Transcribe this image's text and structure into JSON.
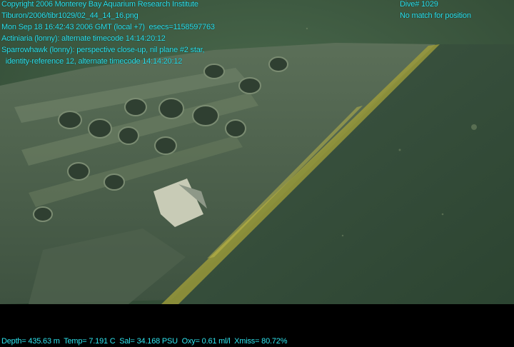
{
  "overlay": {
    "copyright": "Copyright 2006 Monterey Bay Aquarium Research Institute",
    "filename": "Tiburon/2006/tibr1029/02_44_14_16.png",
    "datetime": "Mon Sep 18 16:42:43 2006 GMT (local +7)  esecs=1158597763",
    "annotation1": "Actiniaria (lonny): alternate timecode 14:14:20:12",
    "annotation2_line1": "Sparrowhawk (lonny): perspective close-up, nil plane #2 star,",
    "annotation2_line2": "  identity-reference 12, alternate timecode 14:14:20:12",
    "dive": "Dive# 1029",
    "position": "No match for position",
    "telemetry": "Depth= 435.63 m  Temp= 7.191 C  Sal= 34.168 PSU  Oxy= 0.61 ml/l  Xmiss= 80.72%"
  },
  "colors": {
    "overlay_text": "#2ee6f0",
    "water": "#3f5a40",
    "wreck": "#5a6e55",
    "yellow_edge": "#a6a13a"
  }
}
